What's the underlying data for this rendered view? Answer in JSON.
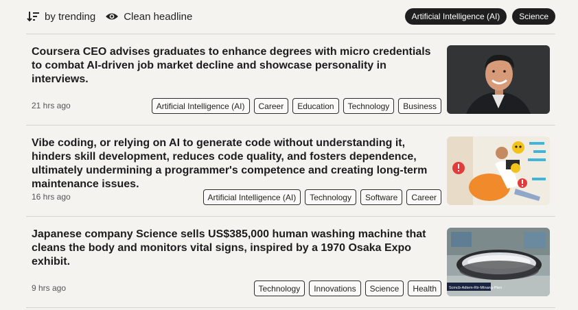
{
  "toolbar": {
    "sort_label": "by trending",
    "view_label": "Clean headline",
    "filters": [
      "Artificial Intelligence (AI)",
      "Science"
    ]
  },
  "articles": [
    {
      "headline": "Coursera CEO advises graduates to enhance degrees with micro credentials to combat AI-driven job market decline and showcase personality in interviews.",
      "time": "21 hrs ago",
      "tags": [
        "Artificial Intelligence (AI)",
        "Career",
        "Education",
        "Technology",
        "Business"
      ],
      "image": "portrait of smiling man in dark suit"
    },
    {
      "headline": "Vibe coding, or relying on AI to generate code without understanding it, hinders skill development, reduces code quality, and fosters dependence, ultimately undermining a programmer's competence and creating long-term maintenance issues.",
      "time": "16 hrs ago",
      "tags": [
        "Artificial Intelligence (AI)",
        "Technology",
        "Software",
        "Career"
      ],
      "image": "illustration of relaxed programmer with laptop and warning icons"
    },
    {
      "headline": "Japanese company Science sells US$385,000 human washing machine that cleans the body and monitors vital signs, inspired by a 1970 Osaka Expo exhibit.",
      "time": "9 hrs ago",
      "tags": [
        "Technology",
        "Innovations",
        "Science",
        "Health"
      ],
      "image": "capsule-shaped human washing machine on display",
      "image_caption": "Scmcb-Adtem-Rtr-Mtnang-Pteri"
    }
  ],
  "colors": {
    "background": "#f4f3f0",
    "chip_dark": "#1f1f1f",
    "divider": "#d6d4cf"
  }
}
